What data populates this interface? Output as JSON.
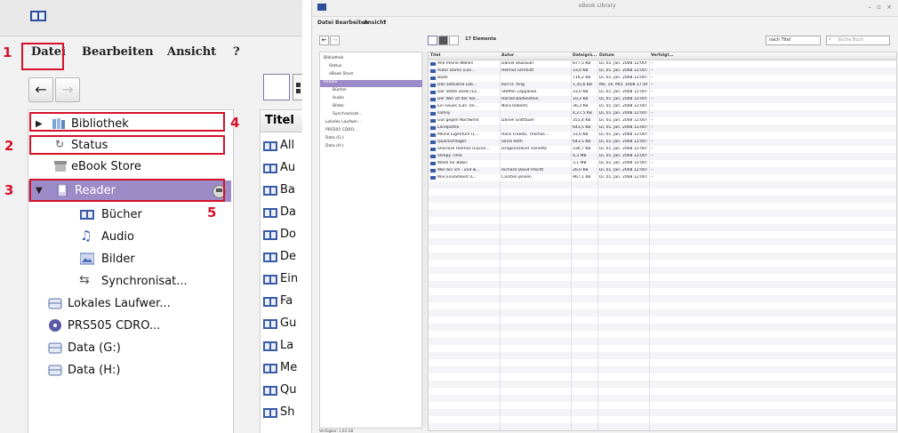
{
  "callouts": {
    "n1": "1",
    "n2": "2",
    "n3": "3",
    "n4": "4",
    "n5": "5"
  },
  "menu": {
    "file": "Datei",
    "edit": "Bearbeiten",
    "view": "Ansicht",
    "help": "?"
  },
  "nav": {
    "back": "←",
    "forward": "→"
  },
  "tree": {
    "library": "Bibliothek",
    "status": "Status",
    "ebook_store": "eBook Store",
    "reader": "Reader",
    "books": "Bücher",
    "audio": "Audio",
    "pictures": "Bilder",
    "sync": "Synchronisat...",
    "local_drive": "Lokales Laufwer...",
    "cdrom": "PRS505 CDRO...",
    "data_g": "Data (G:)",
    "data_h": "Data (H:)"
  },
  "list": {
    "title_header": "Titel",
    "rows": [
      "All",
      "Au",
      "Ba",
      "Da",
      "Do",
      "De",
      "Ein",
      "Fa",
      "Gu",
      "La",
      "Me",
      "Qu",
      "Sh"
    ]
  },
  "window": {
    "title": "eBook Library",
    "controls": "– ▫ ×",
    "menu": [
      "Datei",
      "Bearbeiten",
      "Ansicht",
      "?"
    ],
    "view_count": "17 Elemente",
    "search_dropdown": "nach Titel",
    "search_placeholder": "Suche Buch",
    "columns": [
      "Titel",
      "Autor",
      "Dateigrö...",
      "Datum",
      "Verfolgt..."
    ],
    "tree": [
      "Bibliothek",
      "Status",
      "eBook Store",
      "Reader",
      "Bücher",
      "Audio",
      "Bilder",
      "Synchronisat...",
      "Lokales Laufwer...",
      "PRS505 CDRO...",
      "Data (G:)",
      "Data (H:)"
    ],
    "rows": [
      {
        "title": "Alle meine Wellen",
        "author": "Daniel Stußauer",
        "size": "877,5 KB",
        "date": "Di, 01. Jan. 2008 12:00:00",
        "tracked": "–"
      },
      {
        "title": "Autor Demo (Lan...",
        "author": "Helmut Schmidt",
        "size": "33,0 KB",
        "date": "Di, 01. Jan. 2008 12:00:00",
        "tracked": "–"
      },
      {
        "title": "Bade",
        "author": "",
        "size": "716,2 KB",
        "date": "Di, 01. Jan. 2008 12:00:00",
        "tracked": "–"
      },
      {
        "title": "Das seltsame Leb...",
        "author": "Karl H. Ping",
        "size": "1,35,6 KB",
        "date": "Mo, 16. Mrz. 2008 17:44:17",
        "tracked": "–"
      },
      {
        "title": "Der letzte Dede (La...",
        "author": "Steffen Lappanke",
        "size": "33,0 KB",
        "date": "Di, 01. Jan. 2008 12:00:00",
        "tracked": "–"
      },
      {
        "title": "Der Wer ist der hol...",
        "author": "Harald Badenstein",
        "size": "10,3 KB",
        "date": "Di, 01. Jan. 2008 12:00:00",
        "tracked": "–"
      },
      {
        "title": "Ein neues (Lan Tre...",
        "author": "Nora Roberts",
        "size": "36,3 KB",
        "date": "Di, 01. Jan. 2008 12:00:00",
        "tracked": "–"
      },
      {
        "title": "Family",
        "author": "",
        "size": "4,27,5 KB",
        "date": "Di, 01. Jan. 2008 12:00:00",
        "tracked": "–"
      },
      {
        "title": "Gut gegen Nordwind",
        "author": "Daniel Glattauer",
        "size": "355,4 KB",
        "date": "Di, 01. Jan. 2008 12:00:00",
        "tracked": "–"
      },
      {
        "title": "Landpartie",
        "author": "",
        "size": "643,5 KB",
        "date": "Di, 01. Jan. 2008 12:00:00",
        "tracked": "–"
      },
      {
        "title": "Meine Eigentum (L...",
        "author": "Hans Fraede, Thomas...",
        "size": "33,0 KB",
        "date": "Di, 01. Jan. 2008 12:00:00",
        "tracked": "–"
      },
      {
        "title": "Quarzschläger",
        "author": "Silvia Roth",
        "size": "643,5 KB",
        "date": "Di, 01. Jan. 2008 12:00:00",
        "tracked": "–"
      },
      {
        "title": "Sherlock Holmes (Lavon...",
        "author": "Dragon/David Tronetto",
        "size": "336,7 KB",
        "date": "Di, 01. Jan. 2008 12:00:00",
        "tracked": "–"
      },
      {
        "title": "Sleepy Time",
        "author": "",
        "size": "4,3 MB",
        "date": "Di, 01. Jan. 2008 12:00:00",
        "tracked": "–"
      },
      {
        "title": "Waldi für Bobis",
        "author": "",
        "size": "3,1 MB",
        "date": "Di, 01. Jan. 2008 12:00:00",
        "tracked": "–"
      },
      {
        "title": "Wer bin ich - und w...",
        "author": "Richard David Precht",
        "size": "26,0 KB",
        "date": "Di, 01. Jan. 2008 12:00:00",
        "tracked": "–"
      },
      {
        "title": "Wie Einsamkeit (L...",
        "author": "Carsten Jensen",
        "size": "967,1 KB",
        "date": "Di, 01. Jan. 2008 12:00:00",
        "tracked": "–"
      }
    ],
    "status_text": "Verfügbar: 1,63 GB"
  },
  "colors": {
    "selection": "#9b8bc6",
    "callout": "#d5112b"
  }
}
